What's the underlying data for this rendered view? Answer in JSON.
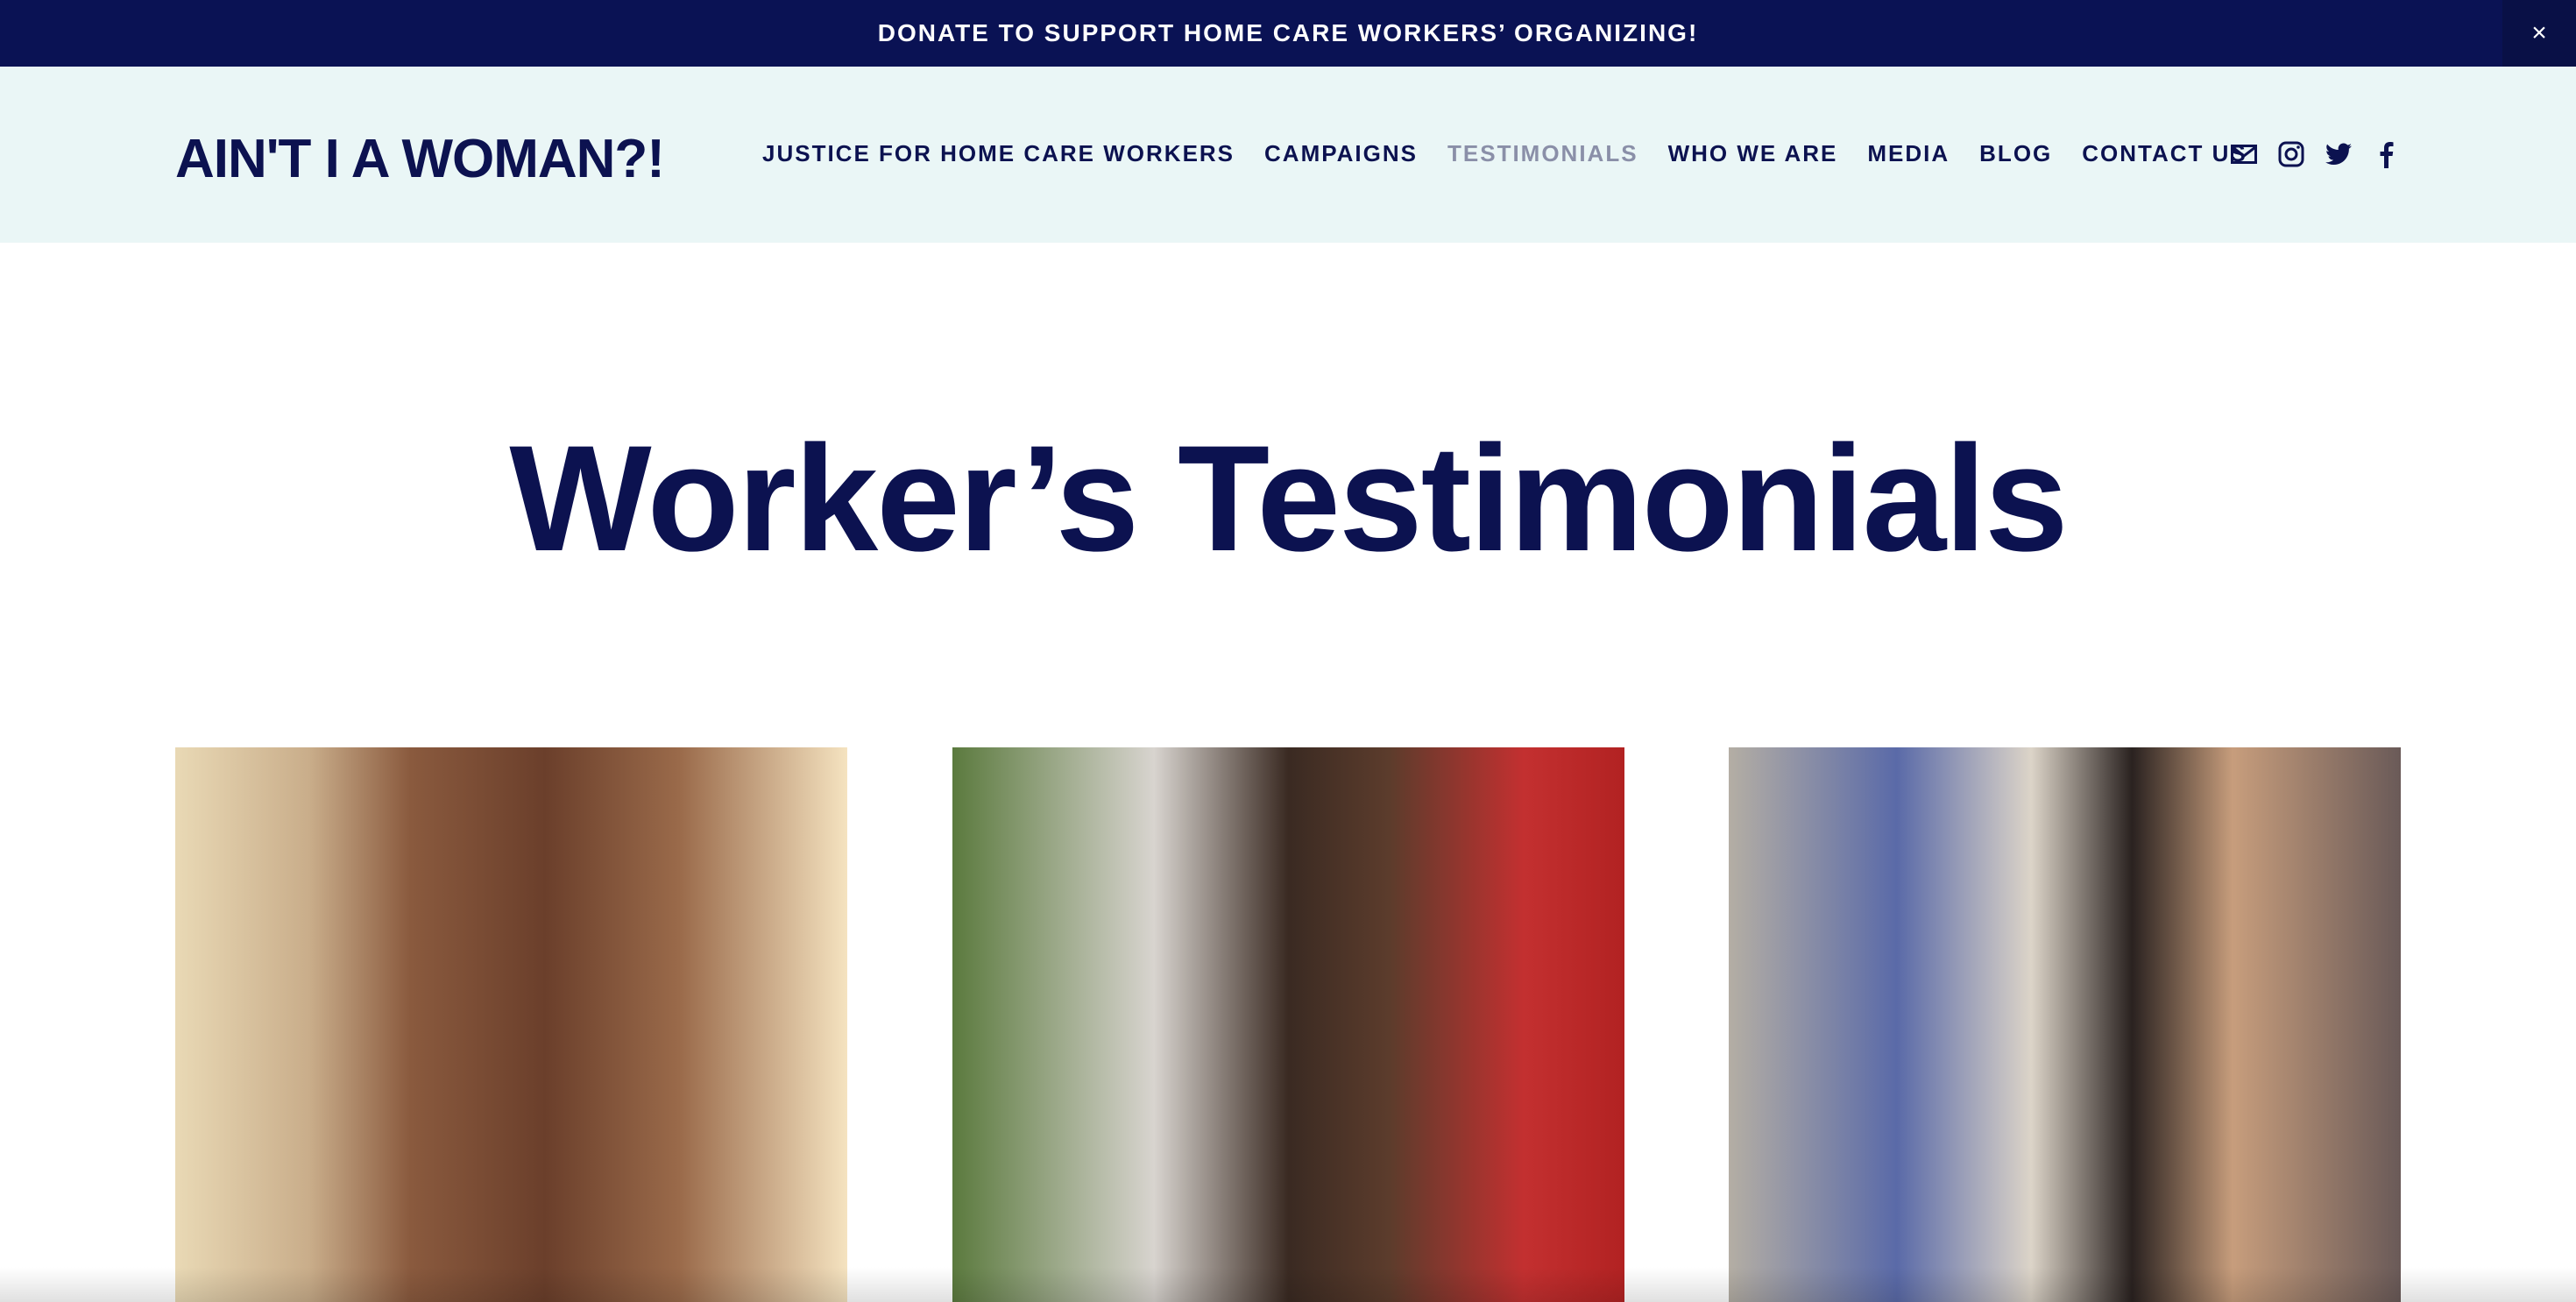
{
  "banner": {
    "text": "DONATE TO SUPPORT HOME CARE WORKERS’ ORGANIZING!",
    "close": "×"
  },
  "header": {
    "logo": "AIN'T I A WOMAN?!",
    "nav": [
      "JUSTICE FOR HOME CARE WORKERS",
      "CAMPAIGNS",
      "TESTIMONIALS",
      "WHO WE ARE",
      "MEDIA",
      "BLOG",
      "CONTACT US"
    ],
    "active_nav": "TESTIMONIALS",
    "icons": [
      "email-icon",
      "instagram-icon",
      "twitter-icon",
      "facebook-icon"
    ]
  },
  "main": {
    "title": "Worker’s Testimonials"
  },
  "colors": {
    "primary": "#0c1250",
    "banner": "#0a1254",
    "header_bg": "#eaf6f6",
    "active": "#8a8fa8"
  }
}
